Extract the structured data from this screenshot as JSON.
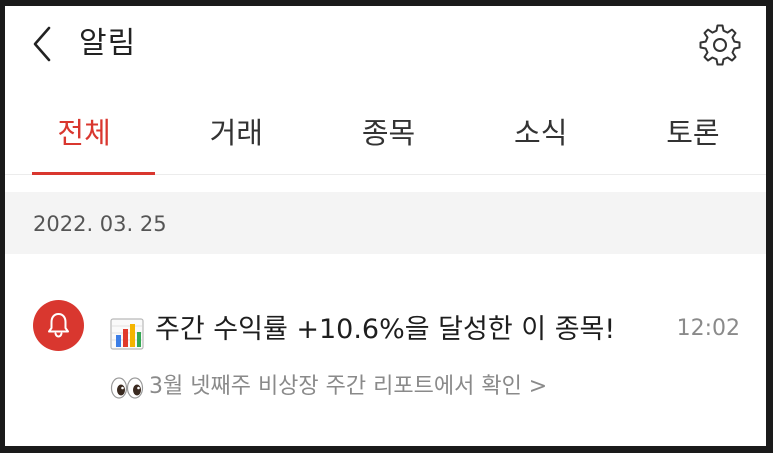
{
  "header": {
    "title": "알림",
    "back_icon": "chevron-left-icon",
    "settings_icon": "gear-icon"
  },
  "tabs": [
    {
      "label": "전체",
      "active": true
    },
    {
      "label": "거래",
      "active": false
    },
    {
      "label": "종목",
      "active": false
    },
    {
      "label": "소식",
      "active": false
    },
    {
      "label": "토론",
      "active": false
    }
  ],
  "date_section": {
    "date": "2022. 03. 25"
  },
  "notification": {
    "icon": "bell-icon",
    "emoji_title": "bar-chart-emoji",
    "title": "주간 수익률 +10.6%을 달성한 이 종목!",
    "time": "12:02",
    "emoji_sub": "eyes-emoji",
    "subtitle": "3월 넷째주 비상장 주간 리포트에서 확인 >"
  },
  "colors": {
    "accent": "#d9372f",
    "text_primary": "#1e1e1e",
    "text_secondary": "#8a8a8a",
    "section_bg": "#f4f4f4"
  }
}
